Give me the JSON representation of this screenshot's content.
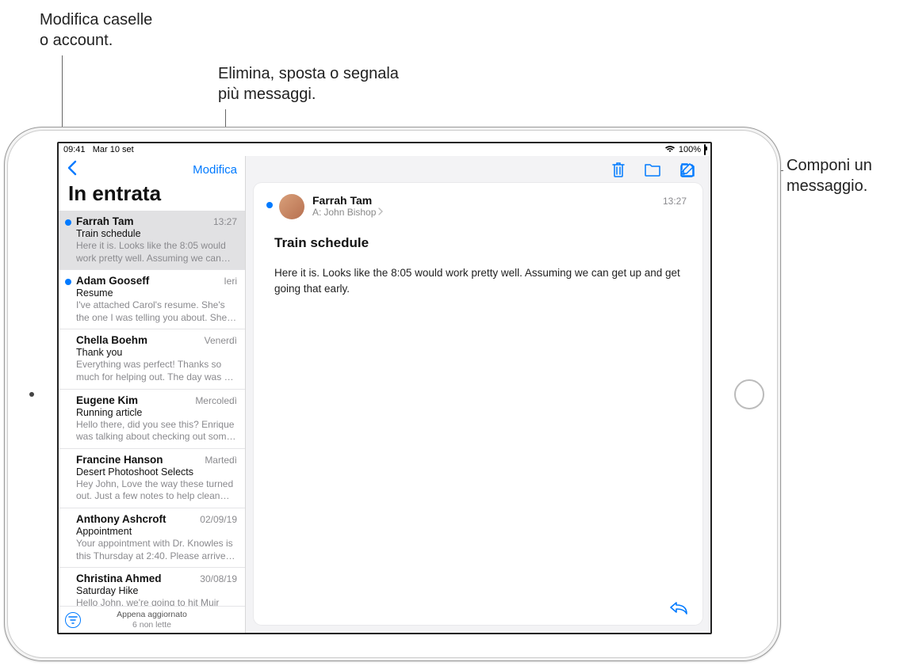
{
  "callouts": {
    "edit_mailboxes": "Modifica caselle\no account.",
    "delete_move": "Elimina, sposta o segnala\npiù messaggi.",
    "compose": "Componi un\nmessaggio."
  },
  "statusbar": {
    "time": "09:41",
    "date": "Mar 10 set",
    "battery": "100%"
  },
  "sidebar": {
    "edit_label": "Modifica",
    "title": "In entrata",
    "messages": [
      {
        "sender": "Farrah Tam",
        "time": "13:27",
        "subject": "Train schedule",
        "preview": "Here it is. Looks like the 8:05 would work pretty well. Assuming we can get…",
        "unread": true,
        "selected": true
      },
      {
        "sender": "Adam Gooseff",
        "time": "Ieri",
        "subject": "Resume",
        "preview": "I've attached Carol's resume. She's the one I was telling you about. She may n…",
        "unread": true,
        "selected": false
      },
      {
        "sender": "Chella Boehm",
        "time": "Venerdì",
        "subject": "Thank you",
        "preview": "Everything was perfect! Thanks so much for helping out. The day was a great su…",
        "unread": false,
        "selected": false
      },
      {
        "sender": "Eugene Kim",
        "time": "Mercoledì",
        "subject": "Running article",
        "preview": "Hello there, did you see this? Enrique was talking about checking out some o…",
        "unread": false,
        "selected": false
      },
      {
        "sender": "Francine Hanson",
        "time": "Martedì",
        "subject": "Desert Photoshoot Selects",
        "preview": "Hey John, Love the way these turned out. Just a few notes to help clean this…",
        "unread": false,
        "selected": false
      },
      {
        "sender": "Anthony Ashcroft",
        "time": "02/09/19",
        "subject": "Appointment",
        "preview": "Your appointment with Dr. Knowles is this Thursday at 2:40. Please arrive by…",
        "unread": false,
        "selected": false
      },
      {
        "sender": "Christina Ahmed",
        "time": "30/08/19",
        "subject": "Saturday Hike",
        "preview": "Hello John, we're going to hit Muir early",
        "unread": false,
        "selected": false
      }
    ],
    "footer_status": "Appena aggiornato",
    "footer_unread": "6 non lette"
  },
  "message": {
    "sender": "Farrah Tam",
    "to_label": "A:",
    "to_name": "John Bishop",
    "time": "13:27",
    "subject": "Train schedule",
    "body": "Here it is. Looks like the 8:05 would work pretty well. Assuming we can get up and get going that early."
  }
}
